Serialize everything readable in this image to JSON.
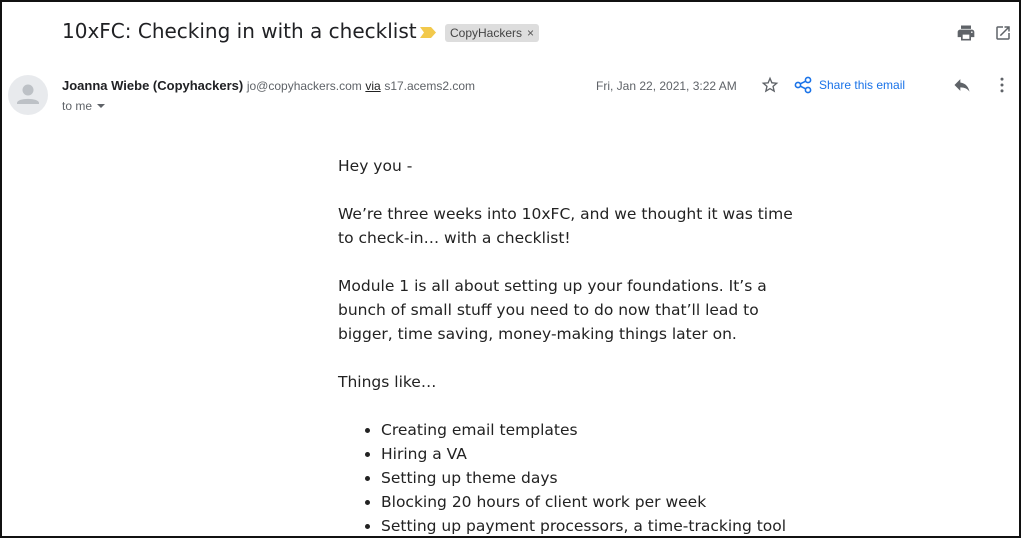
{
  "header": {
    "subject": "10xFC: Checking in with a checklist",
    "label": "CopyHackers",
    "label_remove": "×"
  },
  "sender": {
    "name": "Joanna Wiebe (Copyhackers)",
    "email": "jo@copyhackers.com",
    "via_label": "via",
    "via_domain": "s17.acems2.com",
    "recipient": "to me",
    "date": "Fri, Jan 22, 2021, 3:22 AM",
    "share_label": "Share this email"
  },
  "body": {
    "greeting": "Hey you -",
    "paragraph1": "We’re three weeks into 10xFC, and we thought it was time to check-in… with a checklist!",
    "paragraph2": "Module 1 is all about setting up your foundations. It’s a bunch of small stuff you need to do now that’ll lead to bigger, time saving, money-making things later on.",
    "things_intro": "Things like…",
    "list": [
      "Creating email templates",
      "Hiring a VA",
      "Setting up theme days",
      "Blocking 20 hours of client work per week",
      "Setting up payment processors, a time-tracking tool"
    ]
  },
  "icons": {
    "importance": "importance-marker-icon",
    "print": "print-icon",
    "new_window": "open-in-new-window-icon",
    "avatar": "default-avatar-icon",
    "dropdown": "caret-down-icon",
    "star": "star-icon",
    "share": "share-icon",
    "reply": "reply-icon",
    "more": "more-vertical-icon"
  },
  "colors": {
    "importance": "#f2c94c",
    "label_chip_bg": "#dddddd",
    "share_link": "#1a73e8",
    "icon_gray": "#5f6368"
  }
}
